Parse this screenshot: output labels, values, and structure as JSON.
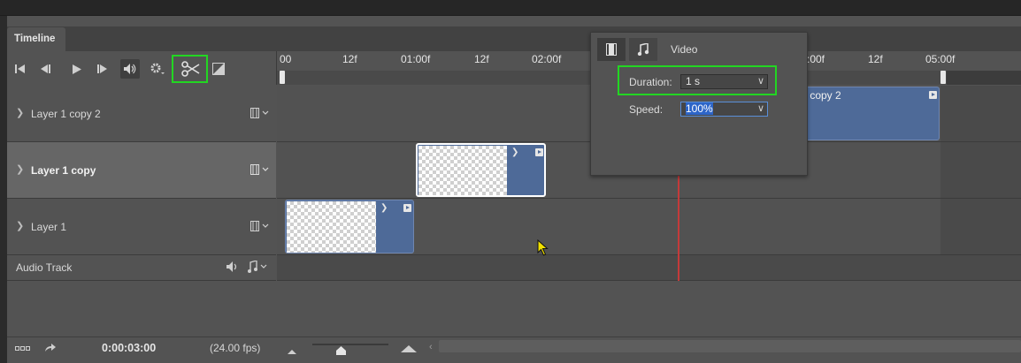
{
  "panel": {
    "tab_label": "Timeline"
  },
  "toolbar": {
    "icons": [
      "go-to-first-frame-icon",
      "previous-frame-icon",
      "play-icon",
      "next-frame-icon",
      "mute-audio-icon",
      "settings-gear-icon",
      "split-at-playhead-scissors-icon",
      "transition-icon"
    ]
  },
  "ruler": {
    "ticks": [
      "00",
      "12f",
      "01:00f",
      "12f",
      "02:00f",
      ":00f",
      "12f",
      "05:00f"
    ]
  },
  "layers": [
    {
      "name": "Layer 1 copy 2",
      "bold": false
    },
    {
      "name": "Layer 1 copy",
      "bold": true
    },
    {
      "name": "Layer 1",
      "bold": false
    }
  ],
  "clips": {
    "layer1copy2_partial_label": "r 1 copy 2"
  },
  "audio": {
    "label": "Audio Track"
  },
  "footer": {
    "timecode": "0:00:03:00",
    "fps": "(24.00 fps)"
  },
  "popup": {
    "header": "Video",
    "duration_label": "Duration:",
    "duration_value": "1 s",
    "speed_label": "Speed:",
    "speed_value": "100%"
  },
  "colors": {
    "clip": "#4e6a98",
    "playhead": "#c43a3a",
    "highlight": "#22d622"
  }
}
